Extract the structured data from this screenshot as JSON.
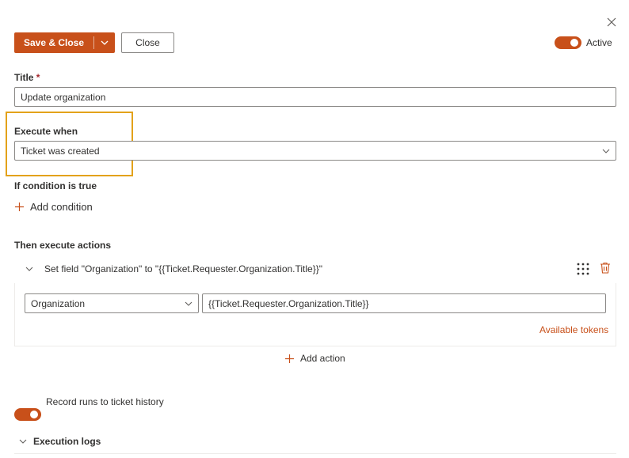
{
  "toolbar": {
    "save_close_label": "Save & Close",
    "close_label": "Close",
    "active_label": "Active"
  },
  "title_field": {
    "label": "Title",
    "required_mark": "*",
    "value": "Update organization"
  },
  "execute_when": {
    "label": "Execute when",
    "value": "Ticket was created"
  },
  "conditions": {
    "label": "If condition is true",
    "add_label": "Add condition"
  },
  "actions": {
    "label": "Then execute actions",
    "items": [
      {
        "summary": "Set field \"Organization\" to \"{{Ticket.Requester.Organization.Title}}\"",
        "field": "Organization",
        "value": "{{Ticket.Requester.Organization.Title}}"
      }
    ],
    "available_tokens_label": "Available tokens",
    "add_label": "Add action"
  },
  "history": {
    "label": "Record runs to ticket history"
  },
  "logs": {
    "label": "Execution logs"
  },
  "colors": {
    "accent": "#c8501a",
    "highlight": "#e3a21a",
    "required": "#a4262c"
  },
  "icons": {
    "close": "close-icon",
    "dropdown": "chevron-down-icon",
    "expand": "chevron-down-icon",
    "drag": "drag-handle-icon",
    "delete": "trash-icon",
    "add": "plus-icon"
  }
}
